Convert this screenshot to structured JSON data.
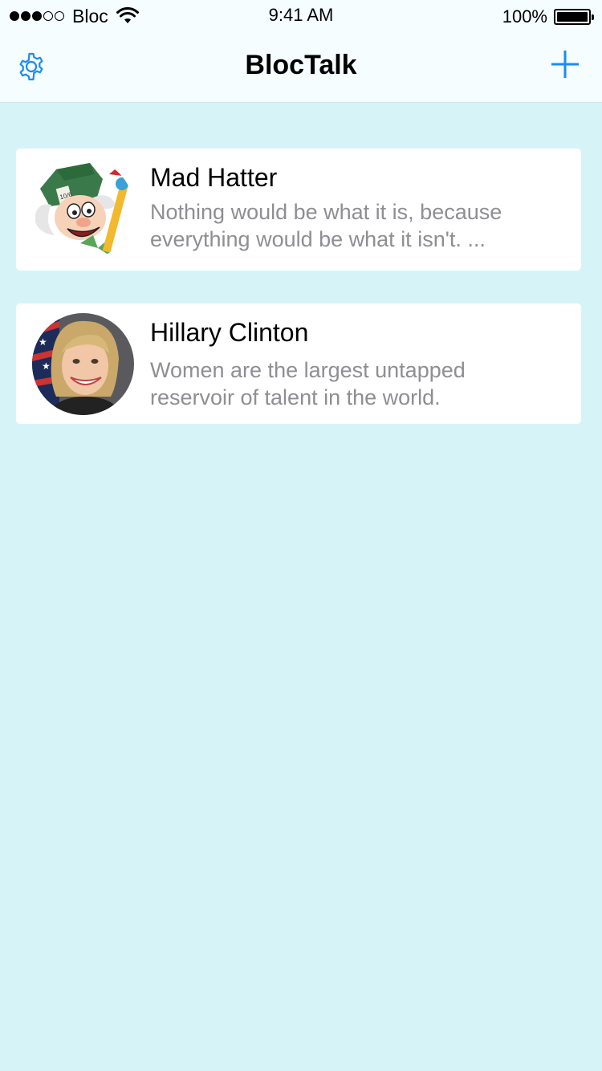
{
  "status_bar": {
    "carrier": "Bloc",
    "time": "9:41 AM",
    "battery": "100%"
  },
  "nav": {
    "title": "BlocTalk",
    "left_icon": "gear-icon",
    "right_icon": "plus-icon",
    "accent_color": "#1a8cf0"
  },
  "conversations": [
    {
      "name": "Mad Hatter",
      "line1": "Nothing would be what it is, because",
      "line2": "everything would be what it isn't. ..."
    },
    {
      "name": "Hillary Clinton",
      "line1": "Women are the largest untapped",
      "line2": "reservoir of talent in the world."
    }
  ],
  "colors": {
    "background": "#d6f4f8",
    "secondary_text": "#8e8e93"
  }
}
